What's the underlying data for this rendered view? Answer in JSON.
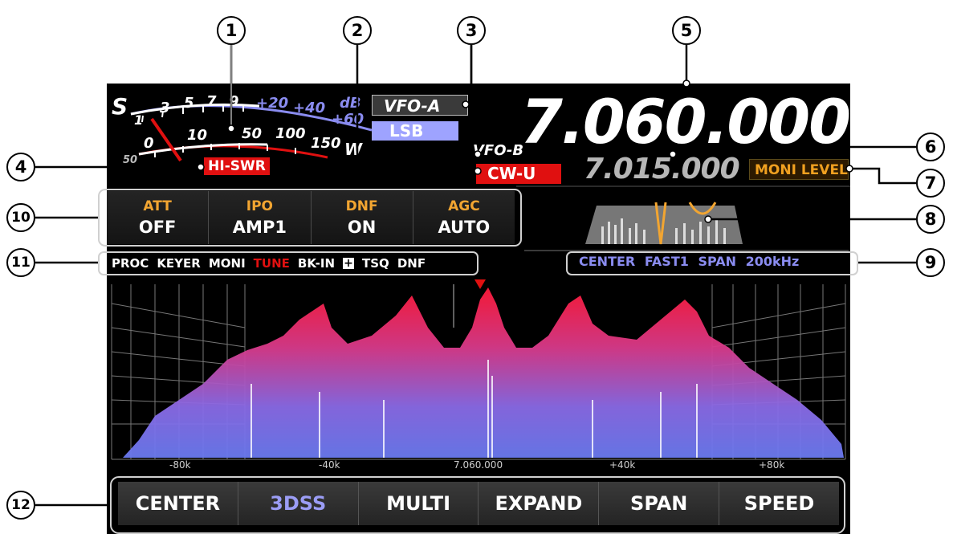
{
  "callouts": [
    "1",
    "2",
    "3",
    "4",
    "5",
    "6",
    "7",
    "8",
    "9",
    "10",
    "11",
    "12"
  ],
  "meter": {
    "s_label": "S",
    "s_scale": [
      "1",
      "3",
      "5",
      "7",
      "9"
    ],
    "db_scale": [
      "+20",
      "+40",
      "+60"
    ],
    "db_unit": "dB",
    "power_scale": [
      "0",
      "10",
      "50",
      "100",
      "150"
    ],
    "power_unit": "W",
    "extra_low": "50"
  },
  "vfo": {
    "vfo_a_label": "VFO-A",
    "vfo_a_mode": "LSB",
    "vfo_b_label": "VFO-B",
    "vfo_b_mode": "CW-U",
    "main_freq": "7.060.000",
    "sub_freq": "7.015.000",
    "moni_level": "MONI LEVEL",
    "hi_swr": "HI-SWR"
  },
  "functions": [
    {
      "label": "ATT",
      "value": "OFF"
    },
    {
      "label": "IPO",
      "value": "AMP1"
    },
    {
      "label": "DNF",
      "value": "ON"
    },
    {
      "label": "AGC",
      "value": "AUTO"
    }
  ],
  "status_items": [
    {
      "text": "PROC",
      "active": false
    },
    {
      "text": "KEYER",
      "active": false
    },
    {
      "text": "MONI",
      "active": false
    },
    {
      "text": "TUNE",
      "active": true
    },
    {
      "text": "BK-IN",
      "active": false
    },
    {
      "text": "+",
      "box": true
    },
    {
      "text": "TSQ",
      "active": false
    },
    {
      "text": "DNF",
      "active": false
    }
  ],
  "scope": {
    "mode": "CENTER",
    "speed": "FAST1",
    "span_label": "SPAN",
    "span_value": "200kHz",
    "axis_labels": [
      "-80k",
      "-40k",
      "7.060.000",
      "+40k",
      "+80k"
    ]
  },
  "buttons": [
    {
      "label": "CENTER",
      "selected": false
    },
    {
      "label": "3DSS",
      "selected": true
    },
    {
      "label": "MULTI",
      "selected": false
    },
    {
      "label": "EXPAND",
      "selected": false
    },
    {
      "label": "SPAN",
      "selected": false
    },
    {
      "label": "SPEED",
      "selected": false
    }
  ],
  "colors": {
    "accent_orange": "#f2a531",
    "accent_blue": "#8a8cf0",
    "alert_red": "#e01010"
  }
}
